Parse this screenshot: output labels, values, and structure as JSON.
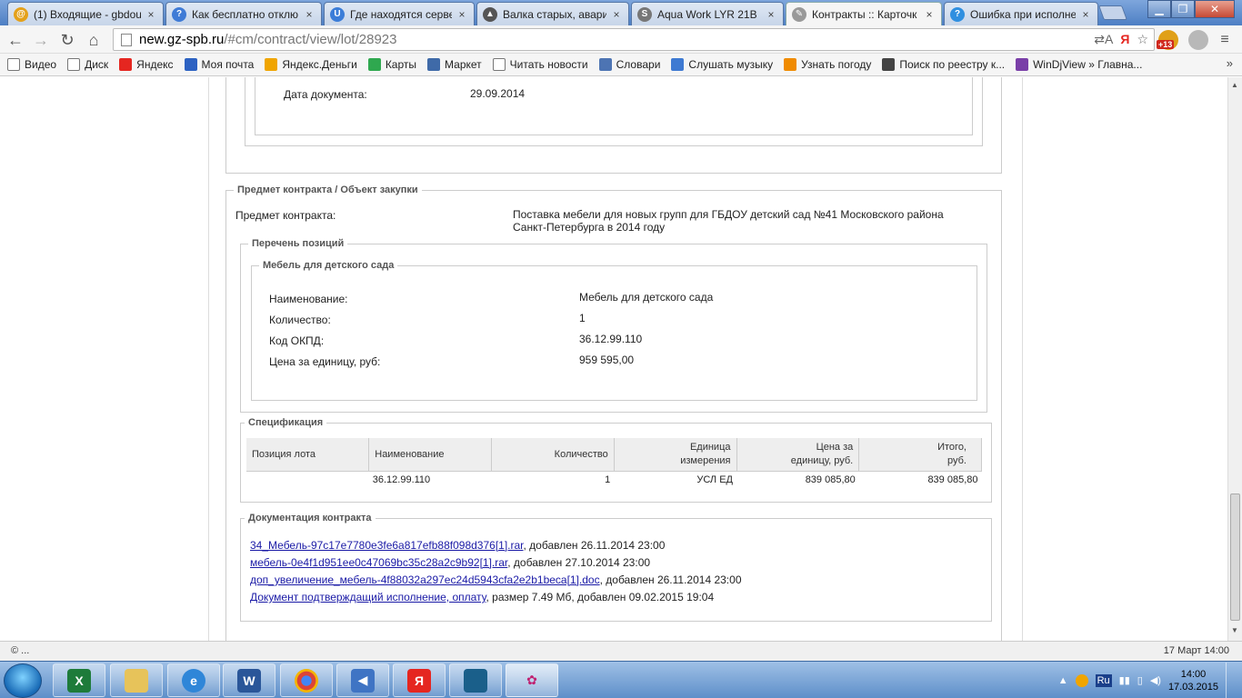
{
  "browser": {
    "tabs": [
      {
        "title": "(1) Входящие - gbdou",
        "favicon_color": "#e4a11b",
        "favicon": "@"
      },
      {
        "title": "Как бесплатно отклю",
        "favicon_color": "#3f7bd6",
        "favicon": "?"
      },
      {
        "title": "Где находятся сервер",
        "favicon_color": "#3b7dd8",
        "favicon": "U"
      },
      {
        "title": "Валка старых, аварий",
        "favicon_color": "#555555",
        "favicon": "▲"
      },
      {
        "title": "Aqua Work LYR 21B",
        "favicon_color": "#777777",
        "favicon": "S"
      },
      {
        "title": "Контракты :: Карточк",
        "favicon_color": "#999999",
        "favicon": "✎"
      },
      {
        "title": "Ошибка при исполне",
        "favicon_color": "#2f8fe0",
        "favicon": "?"
      }
    ],
    "active_tab_index": 5,
    "url_host": "new.gz-spb.ru",
    "url_path": "/#cm/contract/view/lot/28923",
    "extension_badge": "+13"
  },
  "bookmarks": [
    {
      "label": "Видео",
      "icon_color": "#ffffff"
    },
    {
      "label": "Диск",
      "icon_color": "#ffffff"
    },
    {
      "label": "Яндекс",
      "icon_color": "#e52620"
    },
    {
      "label": "Моя почта",
      "icon_color": "#2d62c2"
    },
    {
      "label": "Яндекс.Деньги",
      "icon_color": "#f0a500"
    },
    {
      "label": "Карты",
      "icon_color": "#2fa84f"
    },
    {
      "label": "Маркет",
      "icon_color": "#3f6aa8"
    },
    {
      "label": "Читать новости",
      "icon_color": "#ffffff"
    },
    {
      "label": "Словари",
      "icon_color": "#4d74b3"
    },
    {
      "label": "Слушать музыку",
      "icon_color": "#3e7ad2"
    },
    {
      "label": "Узнать погоду",
      "icon_color": "#f08b00"
    },
    {
      "label": "Поиск по реестру к...",
      "icon_color": "#444444"
    },
    {
      "label": "WinDjView » Главна...",
      "icon_color": "#7a3fa8"
    }
  ],
  "bookmarks_more": "»",
  "doc_section": {
    "date_label": "Дата документа:",
    "date_value": "29.09.2014"
  },
  "subject_section": {
    "legend": "Предмет контракта / Объект закупки",
    "subject_label": "Предмет контракта:",
    "subject_value_line1": "Поставка мебели для новых групп для ГБДОУ детский сад №41 Московского района",
    "subject_value_line2": "Санкт-Петербурга в 2014 году",
    "positions_legend": "Перечень позиций",
    "item_legend": "Мебель для детского сада",
    "item_fields": [
      {
        "label": "Наименование:",
        "value": "Мебель для детского сада"
      },
      {
        "label": "Количество:",
        "value": "1"
      },
      {
        "label": "Код ОКПД:",
        "value": "36.12.99.110"
      },
      {
        "label": "Цена за единицу, руб:",
        "value": "959 595,00"
      }
    ]
  },
  "specification": {
    "legend": "Спецификация",
    "headers": {
      "position": "Позиция лота",
      "name": "Наименование",
      "quantity": "Количество",
      "unit_line1": "Единица",
      "unit_line2": "измерения",
      "price_line1": "Цена за",
      "price_line2": "единицу, руб.",
      "total_line1": "Итого,",
      "total_line2": "руб."
    },
    "row": {
      "position": "",
      "name": "36.12.99.110",
      "quantity": "1",
      "unit": "УСЛ ЕД",
      "price": "839 085,80",
      "total": "839 085,80"
    }
  },
  "documentation": {
    "legend": "Документация контракта",
    "items": [
      {
        "link": "34_Мебель-97c17e7780e3fe6a817efb88f098d376[1].rar",
        "suffix": ", добавлен 26.11.2014 23:00"
      },
      {
        "link": "мебель-0e4f1d951ee0c47069bc35c28a2c9b92[1].rar",
        "suffix": ", добавлен 27.10.2014 23:00"
      },
      {
        "link": "доп_увеличение_мебель-4f88032a297ec24d5943cfa2e2b1beca[1].doc",
        "suffix": ", добавлен 26.11.2014 23:00"
      },
      {
        "link": "Документ подтверждащий исполнение, оплату",
        "suffix": ", размер 7.49 Мб, добавлен 09.02.2015 19:04"
      }
    ]
  },
  "status": {
    "left": "© ...",
    "right": "17 Март 14:00"
  },
  "taskbar": {
    "language": "Ru",
    "time": "14:00",
    "date": "17.03.2015"
  }
}
